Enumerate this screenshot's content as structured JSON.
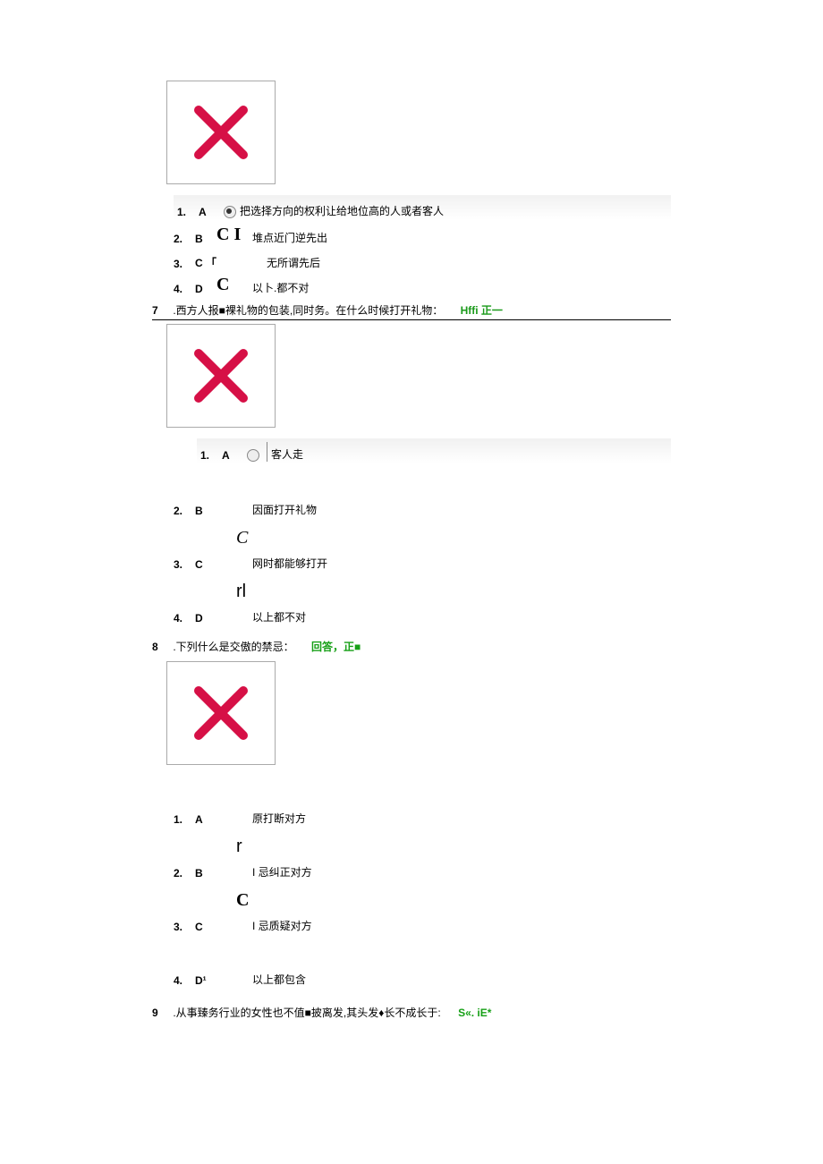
{
  "q6": {
    "options": [
      {
        "num": "1.",
        "letter": "A",
        "mark_radio": true,
        "text": "把选择方向的权利让给地位高的人或者客人"
      },
      {
        "num": "2.",
        "letter": "B",
        "mark": "C  I",
        "text": "堆点近门逆先出"
      },
      {
        "num": "3.",
        "letter": "C 「",
        "mark": "",
        "text": "无所谓先后"
      },
      {
        "num": "4.",
        "letter": "D",
        "mark": "C",
        "text": "以卜.都不对"
      }
    ]
  },
  "q7": {
    "num": "7",
    "text": ".西方人报■裸礼物的包装,同时务。在什么时候打开礼物：",
    "answer": "Hffi 正一",
    "options": [
      {
        "num": "1.",
        "letter": "A",
        "mark_radio_empty": true,
        "text": "客人走"
      },
      {
        "num": "2.",
        "letter": "B",
        "text": "因面打开礼物"
      },
      {
        "num": "3.",
        "letter": "C",
        "stack": "C",
        "stack_class": "ci",
        "text": "网时都能够打开"
      },
      {
        "num": "4.",
        "letter": "D",
        "stack": "rl",
        "stack_class": "r",
        "text": "以上都不对"
      }
    ]
  },
  "q8": {
    "num": "8",
    "text": ".下列什么是交傲的禁忌：",
    "answer": "回答，正■",
    "options": [
      {
        "num": "1.",
        "letter": "A",
        "text": "原打断对方"
      },
      {
        "num": "2.",
        "letter": "B",
        "stack": "r",
        "stack_class": "r",
        "text": "I 忌纠正对方"
      },
      {
        "num": "3.",
        "letter": "C",
        "stack": "C",
        "stack_class": "",
        "text": "I 忌质疑对方"
      },
      {
        "num": "4.",
        "letter": "D¹",
        "text": "以上都包含"
      }
    ]
  },
  "q9": {
    "num": "9",
    "text": ".从事臻务行业的女性也不值■披离发,其头发♦长不成长于:",
    "answer": "S«. iE*"
  }
}
